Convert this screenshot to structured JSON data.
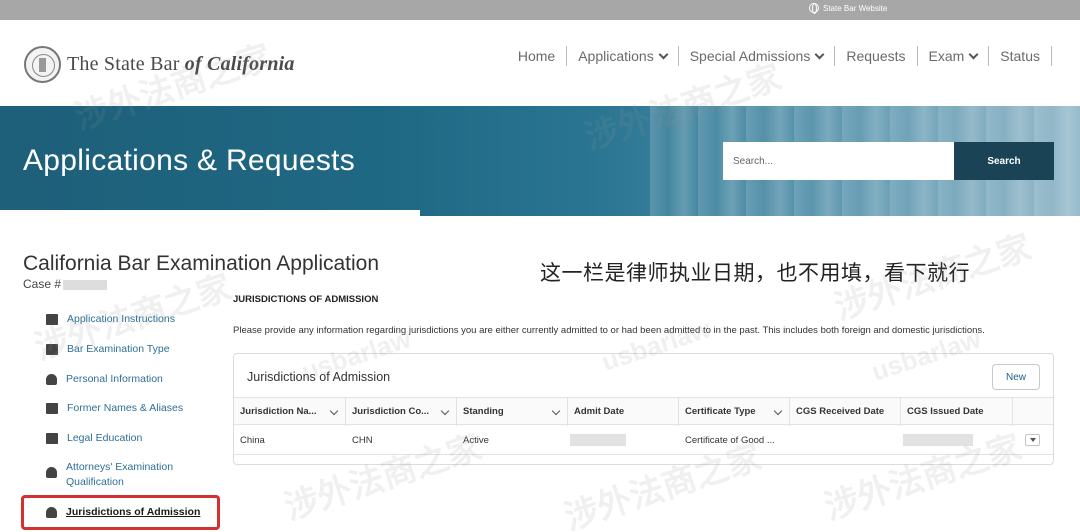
{
  "top_bar": {
    "link": "State Bar Website",
    "icon": "globe-icon"
  },
  "logo": {
    "plain": "The State Bar ",
    "italic": "of California",
    "icon": "seal-logo"
  },
  "nav": [
    {
      "label": "Home",
      "dropdown": false
    },
    {
      "label": "Applications",
      "dropdown": true
    },
    {
      "label": "Special Admissions",
      "dropdown": true
    },
    {
      "label": "Requests",
      "dropdown": false
    },
    {
      "label": "Exam",
      "dropdown": true
    },
    {
      "label": "Status",
      "dropdown": false
    }
  ],
  "banner": {
    "title": "Applications & Requests",
    "search_placeholder": "Search...",
    "search_button": "Search"
  },
  "page": {
    "title": "California Bar Examination Application",
    "case_label": "Case #"
  },
  "annotation": "这一栏是律师执业日期，也不用填，看下就行",
  "sidebar": [
    {
      "label": "Application Instructions",
      "icon": "document-icon",
      "active": false
    },
    {
      "label": "Bar Examination Type",
      "icon": "form-icon",
      "active": false
    },
    {
      "label": "Personal Information",
      "icon": "person-icon",
      "active": false
    },
    {
      "label": "Former Names & Aliases",
      "icon": "id-card-icon",
      "active": false
    },
    {
      "label": "Legal Education",
      "icon": "briefcase-icon",
      "active": false
    },
    {
      "label": "Attorneys' Examination Qualification",
      "icon": "attorney-icon",
      "active": false
    },
    {
      "label": "Jurisdictions of Admission",
      "icon": "shield-icon",
      "active": true
    }
  ],
  "section": {
    "heading": "JURISDICTIONS OF ADMISSION",
    "description": "Please provide any information regarding jurisdictions you are either currently admitted to or had been admitted to in the past. This includes both foreign and domestic jurisdictions."
  },
  "panel": {
    "title": "Jurisdictions of Admission",
    "new_button": "New",
    "columns": [
      "Jurisdiction Na...",
      "Jurisdiction Co...",
      "Standing",
      "Admit Date",
      "Certificate Type",
      "CGS Received Date",
      "CGS Issued Date"
    ],
    "rows": [
      {
        "jurisdiction_name": "China",
        "jurisdiction_code": "CHN",
        "standing": "Active",
        "admit_date": "",
        "certificate_type": "Certificate of Good ...",
        "cgs_received_date": "",
        "cgs_issued_date": ""
      }
    ]
  },
  "watermark": {
    "cn": "涉外法商之家",
    "en": "usbarlaw"
  },
  "colors": {
    "banner": "#1f6884",
    "search_button": "#1a4356",
    "link": "#2e6f97",
    "highlight_box": "#d3302f"
  }
}
